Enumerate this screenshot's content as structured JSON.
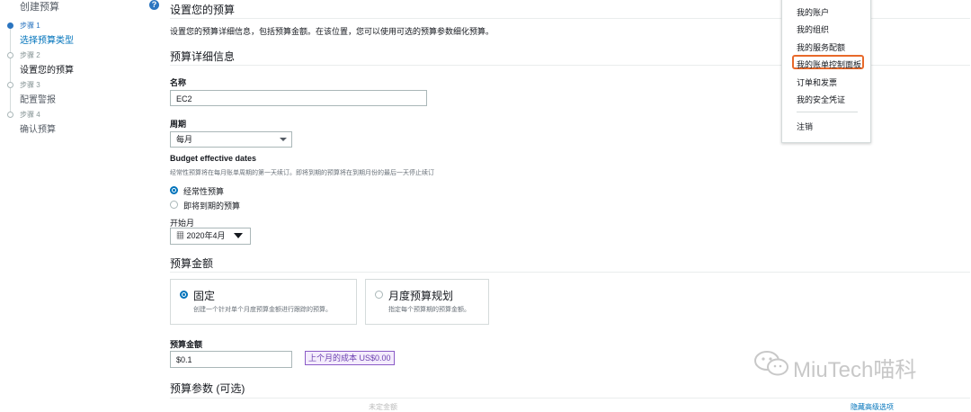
{
  "sidebar": {
    "title": "创建预算",
    "help_icon": "?",
    "steps": [
      {
        "label": "步骤 1",
        "title": "选择预算类型",
        "state": "done"
      },
      {
        "label": "步骤 2",
        "title": "设置您的预算",
        "state": "current"
      },
      {
        "label": "步骤 3",
        "title": "配置警报",
        "state": "pending"
      },
      {
        "label": "步骤 4",
        "title": "确认预算",
        "state": "pending"
      }
    ]
  },
  "main": {
    "title": "设置您的预算",
    "description": "设置您的预算详细信息，包括预算金额。在该位置，您可以使用可选的预算参数细化预算。",
    "details_section": "预算详细信息",
    "name_label": "名称",
    "name_value": "EC2",
    "period_label": "周期",
    "period_value": "每月",
    "effective_label": "Budget effective dates",
    "effective_hint": "经常性预算将在每月账单周期的第一天续订。即将到期的预算将在到期月份的最后一天停止续订",
    "radio_recurring": "经常性预算",
    "radio_expiring": "即将到期的预算",
    "start_month_label": "开始月",
    "start_month_value": "2020年4月",
    "amount_section": "预算金额",
    "card_fixed_title": "固定",
    "card_fixed_desc": "创建一个针对单个月度预算金额进行跟踪的预算。",
    "card_monthly_title": "月度预算规划",
    "card_monthly_desc": "指定每个预算期的预算金额。",
    "budget_amount_label": "预算金额",
    "budget_amount_value": "$0.1",
    "last_month_cost": "上个月的成本 US$0.00",
    "params_section": "预算参数 (可选)",
    "bottom_partial_center": "未定金额",
    "bottom_partial_right": "隐藏高级选项"
  },
  "menu": {
    "items": [
      "我的账户",
      "我的组织",
      "我的服务配额",
      "我的账单控制面板",
      "订单和发票",
      "我的安全凭证",
      "注销"
    ],
    "highlight_color": "#e8692a"
  },
  "watermark": {
    "text": "MiuTech喵科",
    "icon": "wechat-icon"
  },
  "colors": {
    "accent": "#0073bb",
    "badge_border": "#8b5cc7"
  }
}
